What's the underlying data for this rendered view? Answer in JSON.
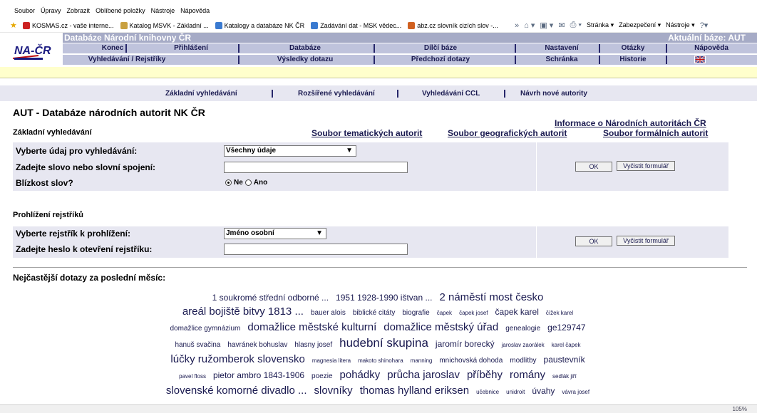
{
  "browser": {
    "menu": [
      "Soubor",
      "Úpravy",
      "Zobrazit",
      "Oblíbené položky",
      "Nástroje",
      "Nápověda"
    ],
    "favorites": [
      {
        "label": "KOSMAS.cz - vaše interne...",
        "icon": "kosmas-icon",
        "color": "#cc2222"
      },
      {
        "label": "Katalog MSVK - Základní ...",
        "icon": "page-icon",
        "color": "#c8a040"
      },
      {
        "label": "Katalogy a databáze NK ČR",
        "icon": "ie-page-icon",
        "color": "#3a7ad0"
      },
      {
        "label": "Zadávání dat - MSK vědec...",
        "icon": "ie-page-icon",
        "color": "#3a7ad0"
      },
      {
        "label": "abz.cz slovník cizích slov -...",
        "icon": "abz-icon",
        "color": "#d06020"
      }
    ],
    "chevron": "»",
    "tools": [
      "Stránka ▾",
      "Zabezpečení ▾",
      "Nástroje ▾"
    ],
    "zoom": "105%"
  },
  "header": {
    "db_title": "Databáze Národní knihovny ČR",
    "current_base": "Aktuální báze:  AUT",
    "logo_text": "NA-ČR",
    "row1": [
      "Konec",
      "Přihlášení",
      "Databáze",
      "Dílčí báze",
      "Nastavení",
      "Otázky",
      "Nápověda"
    ],
    "row2": [
      "Vyhledávání / Rejstříky",
      "Výsledky dotazu",
      "Předchozí dotazy",
      "Schránka",
      "Historie"
    ]
  },
  "subnav": [
    "Základní vyhledávání",
    "Rozšířené vyhledávání",
    "Vyhledávání CCL",
    "Návrh nové autority"
  ],
  "page": {
    "title": "AUT - Databáze národních autorit NK ČR",
    "info_link": "Informace o Národních autoritách ČR",
    "basic_search_label": "Základní vyhledávání",
    "links": [
      "Soubor tematických autorit",
      "Soubor geografických autorit",
      "Soubor formálních autorit"
    ]
  },
  "search_form": {
    "field_label": "Vyberte údaj pro vyhledávání:",
    "field_value": "Všechny údaje",
    "query_label": "Zadejte slovo nebo slovní spojení:",
    "query_value": "",
    "proximity_label": "Blízkost slov?",
    "proximity_options": [
      "Ne",
      "Ano"
    ],
    "proximity_selected": "Ne",
    "ok": "OK",
    "clear": "Vyčistit formulář"
  },
  "browse_form": {
    "section_label": "Prohlížení rejstříků",
    "index_label": "Vyberte rejstřík k prohlížení:",
    "index_value": "Jméno osobní",
    "heading_label": "Zadejte heslo k otevření rejstříku:",
    "heading_value": "",
    "ok": "OK",
    "clear": "Vyčistit formulář"
  },
  "cloud": {
    "label": "Nejčastější dotazy za poslední měsíc:",
    "lines": [
      [
        {
          "text": "1 soukromé střední odborné ...",
          "size": "m"
        },
        {
          "text": "1951 1928-1990 ištvan ...",
          "size": "m"
        },
        {
          "text": "2 náměstí most česko",
          "size": "l"
        }
      ],
      [
        {
          "text": "areál bojiště bitvy 1813 ...",
          "size": "l"
        },
        {
          "text": "bauer alois",
          "size": "s"
        },
        {
          "text": "biblické citáty",
          "size": "s"
        },
        {
          "text": "biografie",
          "size": "s"
        },
        {
          "text": "čapek",
          "size": "xs"
        },
        {
          "text": "čapek josef",
          "size": "xs"
        },
        {
          "text": "čapek karel",
          "size": "m"
        },
        {
          "text": "čížek karel",
          "size": "xs"
        }
      ],
      [
        {
          "text": "domažlice gymnázium",
          "size": "s"
        },
        {
          "text": "domažlice městské kulturní",
          "size": "l"
        },
        {
          "text": "domažlice městský úřad",
          "size": "l"
        },
        {
          "text": "genealogie",
          "size": "s"
        },
        {
          "text": "ge129747",
          "size": "m"
        }
      ],
      [
        {
          "text": "hanuš svačina",
          "size": "s"
        },
        {
          "text": "havránek bohuslav",
          "size": "s"
        },
        {
          "text": "hlasny josef",
          "size": "s"
        },
        {
          "text": "hudební skupina",
          "size": "xl"
        },
        {
          "text": "jaromír borecký",
          "size": "m"
        },
        {
          "text": "jaroslav zaorálek",
          "size": "xs"
        },
        {
          "text": "karel čapek",
          "size": "xs"
        }
      ],
      [
        {
          "text": "lúčky ružomberok slovensko",
          "size": "l"
        },
        {
          "text": "magnesia litera",
          "size": "xs"
        },
        {
          "text": "makoto shinohara",
          "size": "xs"
        },
        {
          "text": "manning",
          "size": "xs"
        },
        {
          "text": "mnichovská dohoda",
          "size": "s"
        },
        {
          "text": "modlitby",
          "size": "s"
        },
        {
          "text": "paustevník",
          "size": "m"
        }
      ],
      [
        {
          "text": "pavel floss",
          "size": "xs"
        },
        {
          "text": "pietor ambro 1843-1906",
          "size": "m"
        },
        {
          "text": "poezie",
          "size": "s"
        },
        {
          "text": "pohádky",
          "size": "l"
        },
        {
          "text": "průcha jaroslav",
          "size": "l"
        },
        {
          "text": "příběhy",
          "size": "l"
        },
        {
          "text": "romány",
          "size": "l"
        },
        {
          "text": "sedlák jiří",
          "size": "xs"
        }
      ],
      [
        {
          "text": "slovenské komorné divadlo ...",
          "size": "l"
        },
        {
          "text": "slovníky",
          "size": "l"
        },
        {
          "text": "thomas hylland eriksen",
          "size": "l"
        },
        {
          "text": "učebnice",
          "size": "xs"
        },
        {
          "text": "unidroit",
          "size": "xs"
        },
        {
          "text": "úvahy",
          "size": "m"
        },
        {
          "text": "vávra josef",
          "size": "xs"
        }
      ]
    ]
  },
  "colors": {
    "header_top": "#a6abc6",
    "header_rows": "#bfc3dc",
    "form_bg": "#e7e7f1",
    "navy_text": "#1a1a50",
    "yellow_bar": "#ffffcc"
  }
}
